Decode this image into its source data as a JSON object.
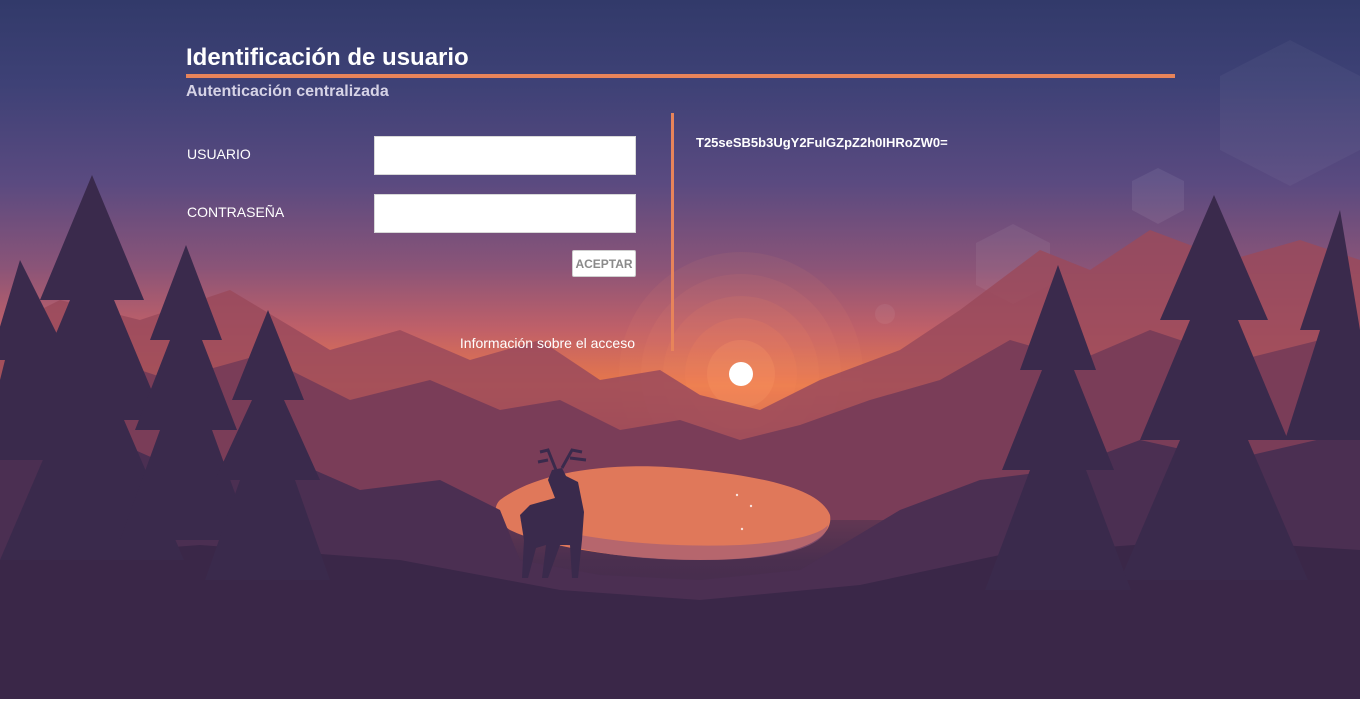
{
  "page": {
    "title": "Identificación de usuario",
    "subtitle": "Autenticación centralizada"
  },
  "form": {
    "username_label": "USUARIO",
    "username_value": "",
    "password_label": "CONTRASEÑA",
    "password_value": "",
    "submit_label": "ACEPTAR",
    "access_info_link": "Información sobre el acceso"
  },
  "side_panel": {
    "token": "T25seSB5b3UgY2FulGZpZ2h0IHRoZW0="
  },
  "colors": {
    "accent": "#e8845a",
    "text": "#ffffff",
    "subtitle": "#d6d3e6",
    "sky_top": "#323a6a",
    "horizon": "#e8784a",
    "foreground": "#3a2748"
  },
  "background": {
    "scene": "sunset mountain landscape with lake, pine forest and deer silhouette"
  }
}
